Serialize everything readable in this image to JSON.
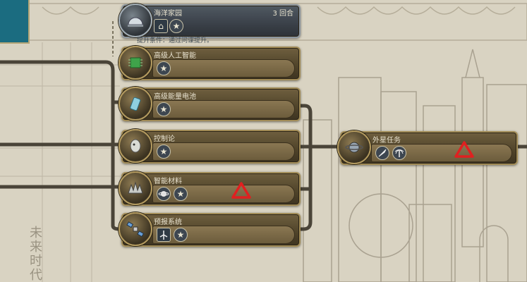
{
  "era_label": "未来时代",
  "nodes": [
    {
      "id": "ocean",
      "title": "海洋家园",
      "turns": "3 回合",
      "requirement": "提升条件：通过问谍提升。",
      "icon": "dome-icon",
      "unlocks": [
        "dome-icon",
        "star-icon"
      ],
      "current": true
    },
    {
      "id": "ai",
      "title": "高级人工智能",
      "icon": "chip-icon",
      "unlocks": [
        "star-icon"
      ]
    },
    {
      "id": "battery",
      "title": "高级能量电池",
      "icon": "battery-icon",
      "unlocks": [
        "star-icon"
      ]
    },
    {
      "id": "cyber",
      "title": "控制论",
      "icon": "cyber-head-icon",
      "unlocks": [
        "star-icon"
      ]
    },
    {
      "id": "smart",
      "title": "智能材料",
      "icon": "spiky-material-icon",
      "unlocks": [
        "saturn-icon",
        "star-icon"
      ],
      "warning": true
    },
    {
      "id": "predict",
      "title": "预报系统",
      "icon": "satellite-icon",
      "unlocks": [
        "windmill-icon",
        "star-icon"
      ]
    },
    {
      "id": "alien",
      "title": "外星任务",
      "icon": "planet-icon",
      "unlocks": [
        "rocket-icon",
        "palm-icon"
      ],
      "warning": true
    }
  ],
  "colors": {
    "warning": "#e02020",
    "parchment": "#d9d3c2",
    "frame_gold": "#a28c57"
  }
}
